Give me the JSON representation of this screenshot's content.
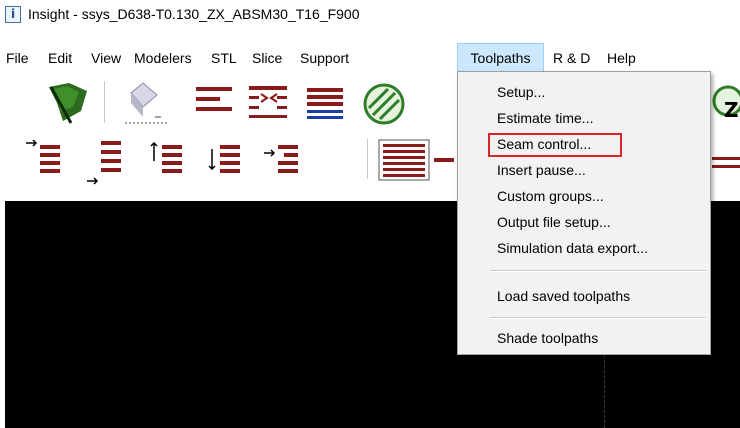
{
  "window": {
    "title": "Insight - ssys_D638-T0.130_ZX_ABSM30_T16_F900",
    "icon": "info-app-icon"
  },
  "menubar": {
    "items": [
      "File",
      "Edit",
      "View",
      "Modelers",
      "STL",
      "Slice",
      "Support",
      "Toolpaths",
      "R & D",
      "Help"
    ],
    "active": "Toolpaths"
  },
  "toolbar1": {
    "buttons": [
      "flag-icon",
      "orient-icon",
      "slice-lines-icon",
      "shrink-lines-icon",
      "layer-lines-icon",
      "circle-hatch-icon"
    ]
  },
  "toolbar2": {
    "buttons": [
      "arrow-right-lines-icon",
      "arrow-bottom-lines-icon",
      "arrow-up-lines-icon",
      "arrow-down-lines-icon",
      "arrow-indent-lines-icon",
      "red-lines-block-icon"
    ]
  },
  "toolpaths_menu": {
    "group1": [
      "Setup...",
      "Estimate time...",
      "Seam control...",
      "Insert pause...",
      "Custom groups...",
      "Output file setup...",
      "Simulation data export..."
    ],
    "group2": [
      "Load saved toolpaths"
    ],
    "group3": [
      "Shade toolpaths"
    ],
    "highlighted": "Seam control..."
  },
  "colors": {
    "accent_red": "#8b1a1a",
    "highlight_border": "#d9262b",
    "menu_active": "#cce8ff",
    "viewport": "#000000"
  }
}
